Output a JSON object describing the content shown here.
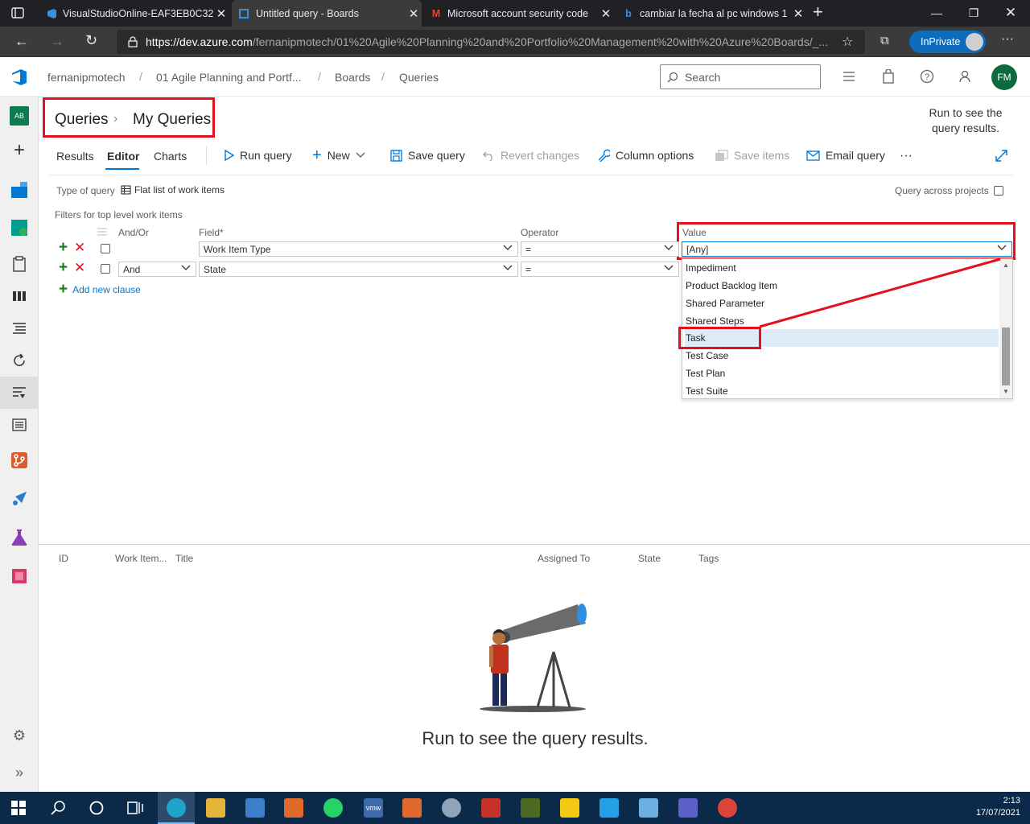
{
  "browser": {
    "tabs": [
      {
        "label": "VisualStudioOnline-EAF3EB0C32"
      },
      {
        "label": "Untitled query - Boards"
      },
      {
        "label": "Microsoft account security code"
      },
      {
        "label": "cambiar la fecha al pc windows 1"
      }
    ],
    "url_host": "https://dev.azure.com",
    "url_rest": "/fernanipmotech/01%20Agile%20Planning%20and%20Portfolio%20Management%20with%20Azure%20Boards/_...",
    "inprivate": "InPrivate"
  },
  "header": {
    "org": "fernanipmotech",
    "project": "01 Agile Planning and Portf...",
    "section": "Boards",
    "page": "Queries",
    "search_placeholder": "Search",
    "avatar_initials": "FM"
  },
  "rail": {
    "project_initials": "AB"
  },
  "breadcrumb": {
    "root": "Queries",
    "folder": "My Queries"
  },
  "notice": "Run to see the query results.",
  "pivots": {
    "results": "Results",
    "editor": "Editor",
    "charts": "Charts"
  },
  "toolbar": {
    "run": "Run query",
    "new": "New",
    "save": "Save query",
    "revert": "Revert changes",
    "columns": "Column options",
    "save_items": "Save items",
    "email": "Email query",
    "more": "···"
  },
  "query": {
    "type_label": "Type of query",
    "type_value": "Flat list of work items",
    "across_projects": "Query across projects",
    "filters_label": "Filters for top level work items",
    "headers": {
      "andor": "And/Or",
      "field": "Field*",
      "operator": "Operator",
      "value": "Value"
    },
    "clauses": [
      {
        "andor": "",
        "field": "Work Item Type",
        "operator": "=",
        "value": "[Any]"
      },
      {
        "andor": "And",
        "field": "State",
        "operator": "=",
        "value": ""
      }
    ],
    "add_clause": "Add new clause"
  },
  "dropdown": {
    "options": [
      "Impediment",
      "Product Backlog Item",
      "Shared Parameter",
      "Shared Steps",
      "Task",
      "Test Case",
      "Test Plan",
      "Test Suite"
    ],
    "highlighted": "Task"
  },
  "results": {
    "columns": [
      "ID",
      "Work Item...",
      "Title",
      "Assigned To",
      "State",
      "Tags"
    ],
    "empty_message": "Run to see the query results."
  },
  "taskbar": {
    "time": "2:13",
    "date": "17/07/2021"
  },
  "colors": {
    "accent": "#0078d4",
    "highlight_box": "#e3101f",
    "add": "#107c10"
  }
}
